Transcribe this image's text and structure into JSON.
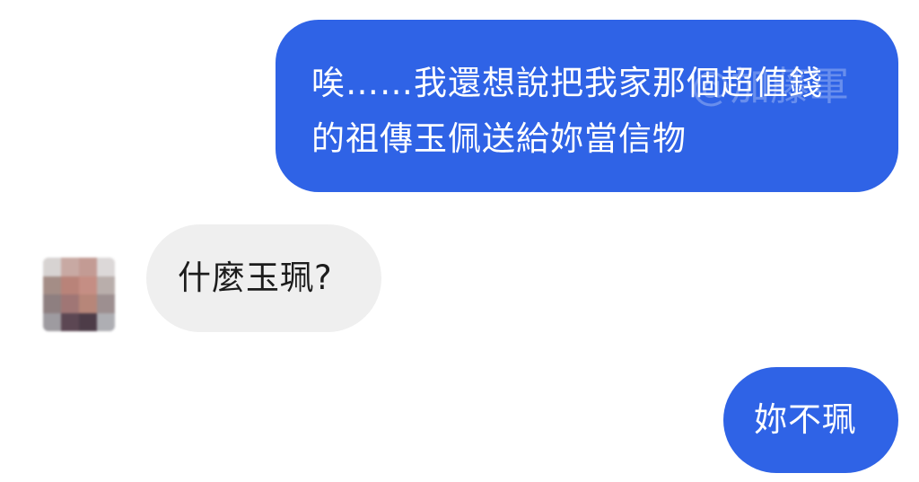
{
  "messages": [
    {
      "sender": "me",
      "text": "唉……我還想說把我家那個超值錢\n的祖傳玉佩送給妳當信物"
    },
    {
      "sender": "other",
      "text": "什麼玉珮?"
    },
    {
      "sender": "me",
      "text": "妳不珮"
    }
  ],
  "watermark": "@加藤軍",
  "avatar": {
    "icon": "pixelated-avatar-icon"
  },
  "colors": {
    "outgoing_bubble": "#2f63e6",
    "incoming_bubble": "#efefef",
    "background": "#ffffff"
  }
}
